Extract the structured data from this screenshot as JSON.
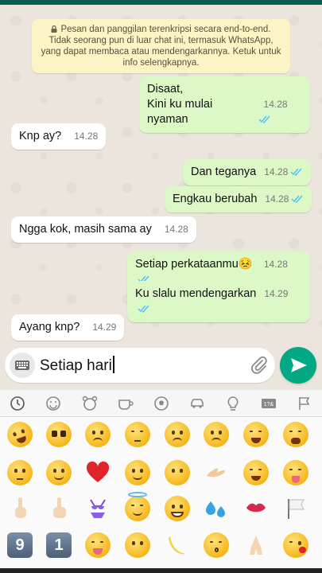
{
  "notice": {
    "text": "Pesan dan panggilan terenkripsi secara end-to-end. Tidak seorang pun di luar chat ini, termasuk WhatsApp, yang dapat membaca atau mendengarkannya. Ketuk untuk info selengkapnya."
  },
  "messages": [
    {
      "dir": "out",
      "line1": "Disaat,",
      "line2": "Kini ku mulai nyaman",
      "time": "14.28"
    },
    {
      "dir": "in",
      "text": "Knp ay?",
      "time": "14.28"
    },
    {
      "dir": "out",
      "text": "Dan teganya",
      "time": "14.28"
    },
    {
      "dir": "out",
      "text": "Engkau berubah",
      "time": "14.28"
    },
    {
      "dir": "in",
      "text": "Ngga kok, masih sama ay",
      "time": "14.28"
    },
    {
      "dir": "out",
      "text": "Setiap perkataanmu",
      "emoji": "😣",
      "time": "14.28"
    },
    {
      "dir": "out",
      "text": "Ku slalu mendengarkan",
      "time": "14.29"
    },
    {
      "dir": "in",
      "text": "Ayang knp?",
      "time": "14.29"
    }
  ],
  "composer": {
    "value": "Setiap hari"
  },
  "emoji_tabs": [
    "recent-icon",
    "smiley-icon",
    "animal-icon",
    "food-icon",
    "activity-icon",
    "travel-icon",
    "objects-icon",
    "symbols-icon",
    "flags-icon"
  ],
  "emoji_numbers": [
    "9",
    "1"
  ],
  "colors": {
    "accent": "#00a884",
    "outgoing": "#dcf8c6",
    "incoming": "#ffffff",
    "read_ticks": "#4fc3f7"
  }
}
